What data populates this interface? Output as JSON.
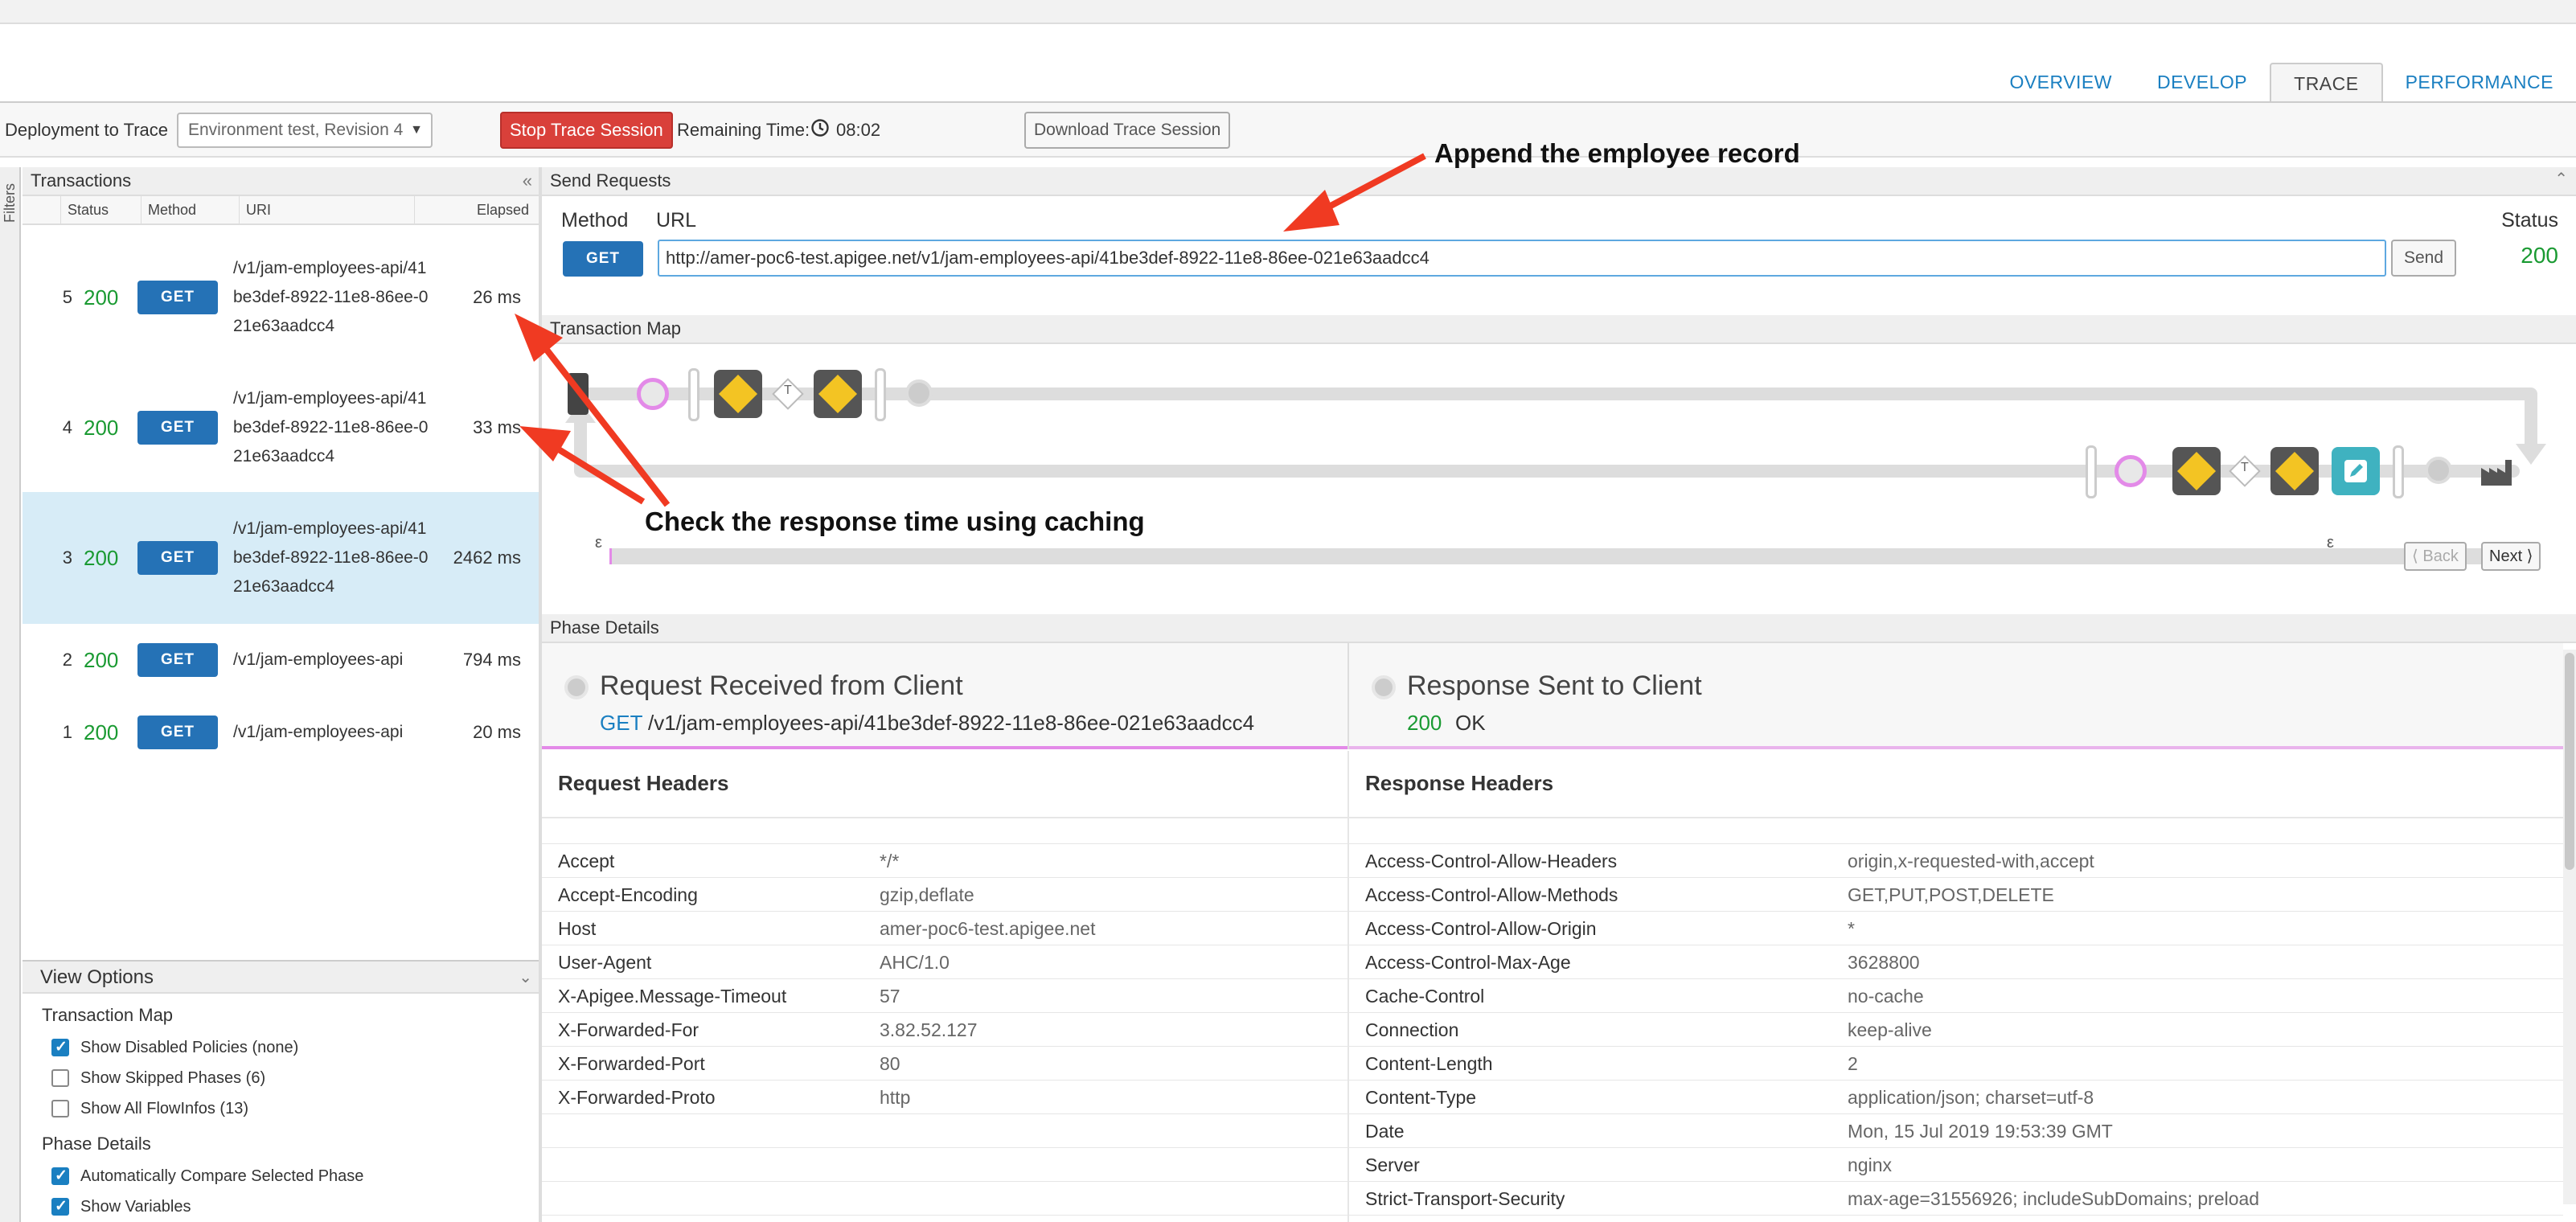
{
  "tabs": [
    {
      "label": "OVERVIEW",
      "active": false
    },
    {
      "label": "DEVELOP",
      "active": false
    },
    {
      "label": "TRACE",
      "active": true
    },
    {
      "label": "PERFORMANCE",
      "active": false
    }
  ],
  "toolbar": {
    "deploy_label": "Deployment to Trace",
    "deploy_value": "Environment test, Revision 4",
    "stop_label": "Stop Trace Session",
    "remaining_label": "Remaining Time:",
    "remaining_value": "08:02",
    "download_label": "Download Trace Session"
  },
  "filters_label": "Filters",
  "transactions": {
    "title": "Transactions",
    "columns": [
      "Status",
      "Method",
      "URI",
      "Elapsed"
    ],
    "rows": [
      {
        "num": "5",
        "status": "200",
        "method": "GET",
        "uri": "/v1/jam-employees-api/41be3def-8922-11e8-86ee-021e63aadcc4",
        "elapsed": "26 ms",
        "selected": false
      },
      {
        "num": "4",
        "status": "200",
        "method": "GET",
        "uri": "/v1/jam-employees-api/41be3def-8922-11e8-86ee-021e63aadcc4",
        "elapsed": "33 ms",
        "selected": false
      },
      {
        "num": "3",
        "status": "200",
        "method": "GET",
        "uri": "/v1/jam-employees-api/41be3def-8922-11e8-86ee-021e63aadcc4",
        "elapsed": "2462 ms",
        "selected": true
      },
      {
        "num": "2",
        "status": "200",
        "method": "GET",
        "uri": "/v1/jam-employees-api",
        "elapsed": "794 ms",
        "selected": false
      },
      {
        "num": "1",
        "status": "200",
        "method": "GET",
        "uri": "/v1/jam-employees-api",
        "elapsed": "20 ms",
        "selected": false
      }
    ]
  },
  "view_options": {
    "title": "View Options",
    "map_section": "Transaction Map",
    "map_items": [
      {
        "label": "Show Disabled Policies (none)",
        "checked": true
      },
      {
        "label": "Show Skipped Phases (6)",
        "checked": false
      },
      {
        "label": "Show All FlowInfos (13)",
        "checked": false
      }
    ],
    "phase_section": "Phase Details",
    "phase_items": [
      {
        "label": "Automatically Compare Selected Phase",
        "checked": true
      },
      {
        "label": "Show Variables",
        "checked": true
      }
    ]
  },
  "send": {
    "title": "Send Requests",
    "method_label": "Method",
    "url_label": "URL",
    "status_label": "Status",
    "method_value": "GET",
    "url_value": "http://amer-poc6-test.apigee.net/v1/jam-employees-api/41be3def-8922-11e8-86ee-021e63aadcc4",
    "send_label": "Send",
    "status_value": "200"
  },
  "map": {
    "title": "Transaction Map",
    "back_label": "Back",
    "next_label": "Next",
    "epsilon": "ε",
    "t_label": "T"
  },
  "phase": {
    "title": "Phase Details",
    "request_title": "Request Received from Client",
    "request_method": "GET",
    "request_path": "/v1/jam-employees-api/41be3def-8922-11e8-86ee-021e63aadcc4",
    "response_title": "Response Sent to Client",
    "response_code": "200",
    "response_text": "OK",
    "req_headers_title": "Request Headers",
    "resp_headers_title": "Response Headers",
    "request_headers": [
      [
        "Accept",
        "*/*"
      ],
      [
        "Accept-Encoding",
        "gzip,deflate"
      ],
      [
        "Host",
        "amer-poc6-test.apigee.net"
      ],
      [
        "User-Agent",
        "AHC/1.0"
      ],
      [
        "X-Apigee.Message-Timeout",
        "57"
      ],
      [
        "X-Forwarded-For",
        "3.82.52.127"
      ],
      [
        "X-Forwarded-Port",
        "80"
      ],
      [
        "X-Forwarded-Proto",
        "http"
      ]
    ],
    "response_headers": [
      [
        "Access-Control-Allow-Headers",
        "origin,x-requested-with,accept"
      ],
      [
        "Access-Control-Allow-Methods",
        "GET,PUT,POST,DELETE"
      ],
      [
        "Access-Control-Allow-Origin",
        "*"
      ],
      [
        "Access-Control-Max-Age",
        "3628800"
      ],
      [
        "Cache-Control",
        "no-cache"
      ],
      [
        "Connection",
        "keep-alive"
      ],
      [
        "Content-Length",
        "2"
      ],
      [
        "Content-Type",
        "application/json; charset=utf-8"
      ],
      [
        "Date",
        "Mon, 15 Jul 2019 19:53:39 GMT"
      ],
      [
        "Server",
        "nginx"
      ],
      [
        "Strict-Transport-Security",
        "max-age=31556926; includeSubDomains; preload"
      ]
    ]
  },
  "annotations": {
    "append": "Append the employee record",
    "caching": "Check the response time using caching"
  },
  "colors": {
    "accent": "#1a7fc1",
    "success": "#1a9a32",
    "danger": "#d9403a",
    "get_button": "#2572b6",
    "arrow": "#f03a22"
  }
}
